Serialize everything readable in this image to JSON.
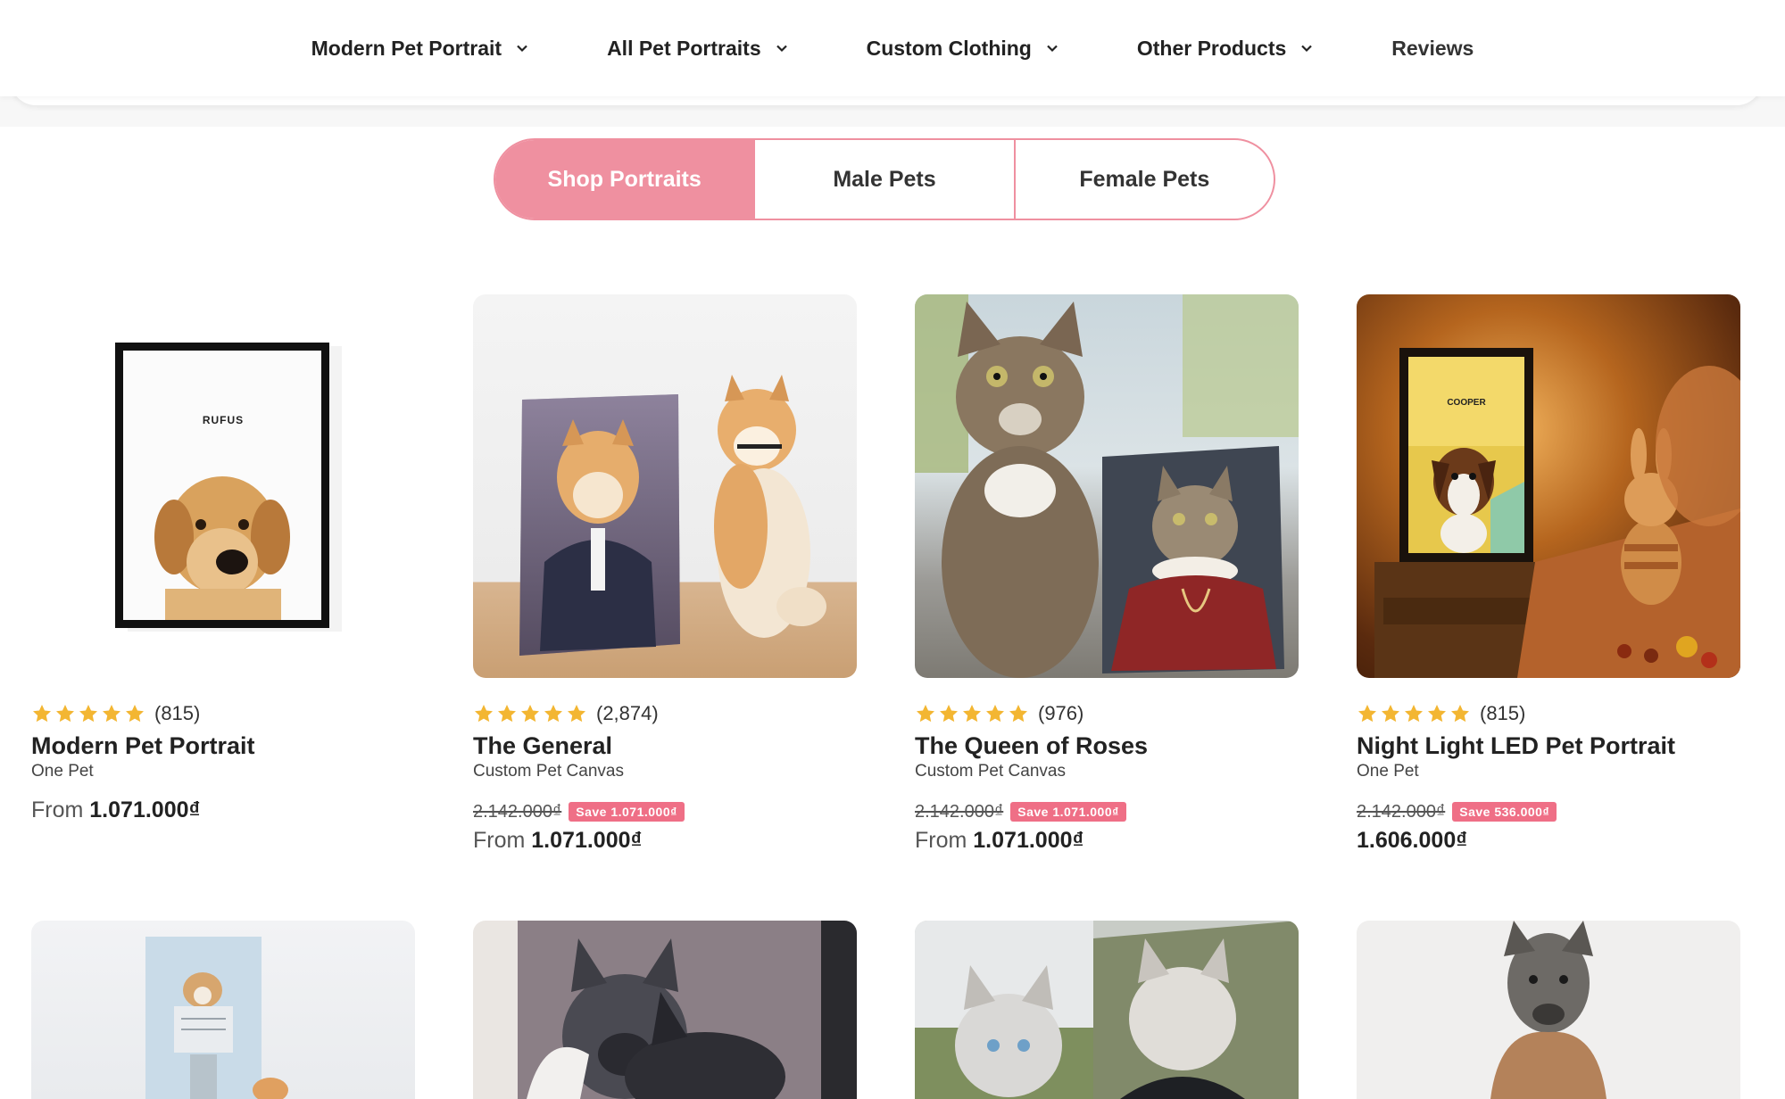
{
  "nav": {
    "items": [
      {
        "label": "Modern Pet Portrait",
        "has_dropdown": true
      },
      {
        "label": "All Pet Portraits",
        "has_dropdown": true
      },
      {
        "label": "Custom Clothing",
        "has_dropdown": true
      },
      {
        "label": "Other Products",
        "has_dropdown": true
      },
      {
        "label": "Reviews",
        "has_dropdown": false
      }
    ]
  },
  "tabs": [
    {
      "label": "Shop Portraits",
      "active": true
    },
    {
      "label": "Male Pets",
      "active": false
    },
    {
      "label": "Female Pets",
      "active": false
    }
  ],
  "products": [
    {
      "rating_count": "(815)",
      "name": "Modern Pet Portrait",
      "subtitle": "One Pet",
      "compare_price": "",
      "save_label": "",
      "from_label": "From",
      "price": "1.071.000₫",
      "art_label": "RUFUS"
    },
    {
      "rating_count": "(2,874)",
      "name": "The General",
      "subtitle": "Custom Pet Canvas",
      "compare_price": "2.142.000₫",
      "save_label": "Save 1.071.000₫",
      "from_label": "From",
      "price": "1.071.000₫"
    },
    {
      "rating_count": "(976)",
      "name": "The Queen of Roses",
      "subtitle": "Custom Pet Canvas",
      "compare_price": "2.142.000₫",
      "save_label": "Save 1.071.000₫",
      "from_label": "From",
      "price": "1.071.000₫"
    },
    {
      "rating_count": "(815)",
      "name": "Night Light LED Pet Portrait",
      "subtitle": "One Pet",
      "compare_price": "2.142.000₫",
      "save_label": "Save 536.000₫",
      "from_label": "",
      "price": "1.606.000₫",
      "art_label": "COOPER"
    }
  ],
  "colors": {
    "accent_pink": "#ef90a0",
    "save_badge": "#ef6f86",
    "star": "#f3b632"
  },
  "icons": {
    "nav_dropdown": "chevron-down-icon",
    "rating": "star-icon"
  }
}
